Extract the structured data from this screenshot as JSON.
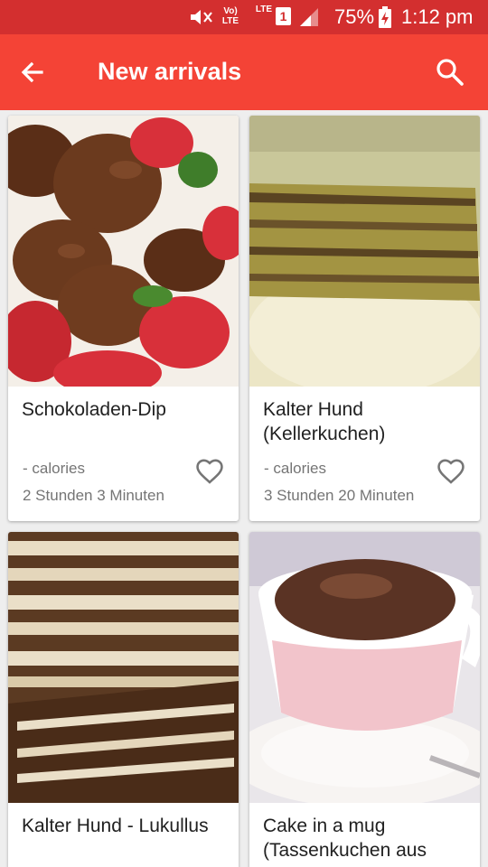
{
  "status_bar": {
    "volte_label": "Vo) LTE",
    "lte_label": "LTE",
    "sim_slot": "1",
    "battery": "75%",
    "clock": "1:12 pm",
    "icons": [
      "mute-icon",
      "volte-icon",
      "signal-icon",
      "battery-charging-icon"
    ]
  },
  "app_bar": {
    "title": "New arrivals",
    "back_icon": "arrow-back-icon",
    "search_icon": "search-icon",
    "color": "#f44336",
    "status_color": "#d32f2f"
  },
  "recipes": [
    {
      "name": "Schokoladen-Dip",
      "calories": "- calories",
      "time": "2 Stunden 3 Minuten",
      "image": "chocolate-strawberries-photo"
    },
    {
      "name": "Kalter Hund (Kellerkuchen)",
      "calories": "- calories",
      "time": "3 Stunden 20 Minuten",
      "image": "layered-cake-photo"
    },
    {
      "name": "Kalter Hund - Lukullus",
      "calories": "",
      "time": "",
      "image": "biscuit-chocolate-cake-photo"
    },
    {
      "name": "Cake in a mug (Tassenkuchen aus",
      "calories": "",
      "time": "",
      "image": "mug-cake-photo"
    }
  ]
}
